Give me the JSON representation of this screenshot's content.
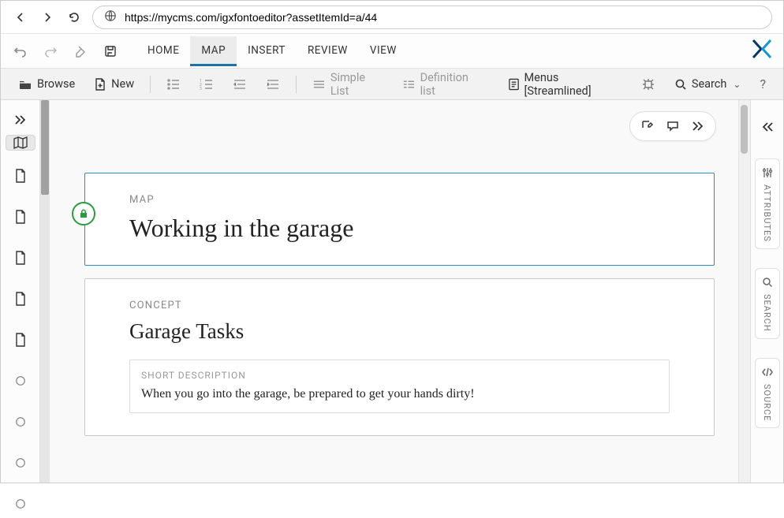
{
  "browser": {
    "url": "https://mycms.com/igxfontoeditor?assetItemId=a/44"
  },
  "menubar": {
    "tabs": [
      "HOME",
      "MAP",
      "INSERT",
      "REVIEW",
      "VIEW"
    ],
    "active_index": 1
  },
  "toolbar": {
    "browse": "Browse",
    "new": "New",
    "simple_list": "Simple List",
    "definition_list": "Definition list",
    "menus": "Menus [Streamlined]",
    "search": "Search",
    "help": "?"
  },
  "editor": {
    "map_card": {
      "eyebrow": "MAP",
      "title": "Working in the garage"
    },
    "concept_card": {
      "eyebrow": "CONCEPT",
      "title": "Garage Tasks",
      "shortdesc_label": "SHORT DESCRIPTION",
      "shortdesc_body": "When you go into the garage, be prepared to get your hands dirty!"
    }
  },
  "right_rail": {
    "panels": [
      "ATTRIBUTES",
      "SEARCH",
      "SOURCE"
    ]
  }
}
